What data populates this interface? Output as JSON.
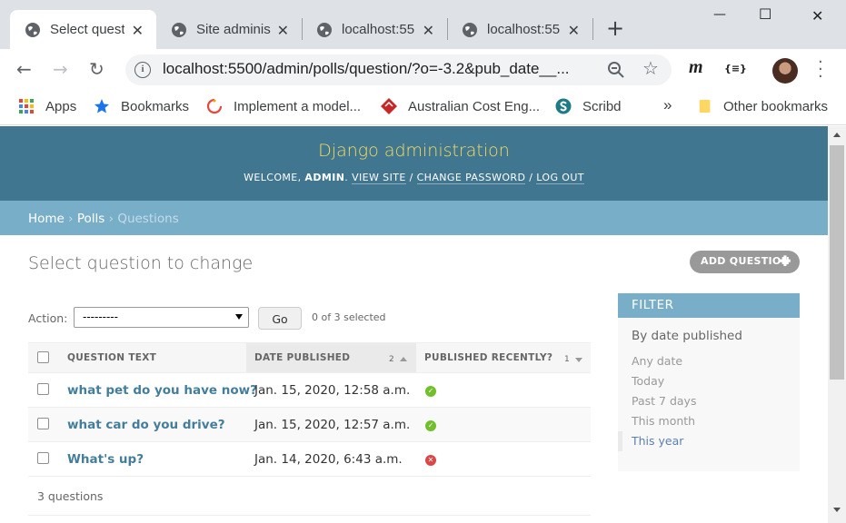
{
  "browser": {
    "tabs": [
      {
        "title": "Select quest",
        "active": true
      },
      {
        "title": "Site adminis",
        "active": false
      },
      {
        "title": "localhost:55",
        "active": false
      },
      {
        "title": "localhost:55",
        "active": false
      }
    ],
    "tab_close": "✕",
    "new_tab": "+",
    "window_controls": {
      "minimize": "—",
      "maximize": "☐",
      "close": "✕"
    },
    "url": "localhost:5500/admin/polls/question/?o=-3.2&pub_date__...",
    "extension_m": "m",
    "extension_json": "{≡}",
    "bookmarks": [
      {
        "label": "Apps",
        "icon": "apps-icon"
      },
      {
        "label": "Bookmarks",
        "icon": "star-icon"
      },
      {
        "label": "Implement a model...",
        "icon": "swirl-icon"
      },
      {
        "label": "Australian Cost Eng...",
        "icon": "diamond-icon"
      },
      {
        "label": "Scribd",
        "icon": "scribd-icon"
      }
    ],
    "bookmarks_overflow": "»",
    "other_bookmarks": "Other bookmarks"
  },
  "django": {
    "branding": "Django administration",
    "welcome": "WELCOME, ",
    "username": "ADMIN",
    "period": ". ",
    "view_site": "VIEW SITE",
    "change_password": "CHANGE PASSWORD",
    "log_out": "LOG OUT",
    "sep": " / ",
    "breadcrumbs": {
      "home": "Home",
      "polls": "Polls",
      "current": "Questions",
      "sep": " › "
    },
    "title": "Select question to change",
    "add_button": "ADD QUESTION",
    "action_label": "Action:",
    "action_value": "---------",
    "go": "Go",
    "selected": "0 of 3 selected",
    "columns": {
      "question_text": "QUESTION TEXT",
      "date_published": "DATE PUBLISHED",
      "date_sort_priority": "2",
      "published_recently": "PUBLISHED RECENTLY?",
      "recent_sort_priority": "1"
    },
    "rows": [
      {
        "question": "what pet do you have now?",
        "date": "Jan. 15, 2020, 12:58 a.m.",
        "recent": true
      },
      {
        "question": "what car do you drive?",
        "date": "Jan. 15, 2020, 12:57 a.m.",
        "recent": true
      },
      {
        "question": "What's up?",
        "date": "Jan. 14, 2020, 6:43 a.m.",
        "recent": false
      }
    ],
    "row_count": "3 questions",
    "filter": {
      "heading": "FILTER",
      "subheading": "By date published",
      "options": [
        "Any date",
        "Today",
        "Past 7 days",
        "This month",
        "This year"
      ],
      "selected": "This year"
    },
    "colors": {
      "header": "#417690",
      "breadcrumbs": "#79aec8",
      "branding": "#f5dd5d",
      "link": "#447e9b"
    }
  }
}
